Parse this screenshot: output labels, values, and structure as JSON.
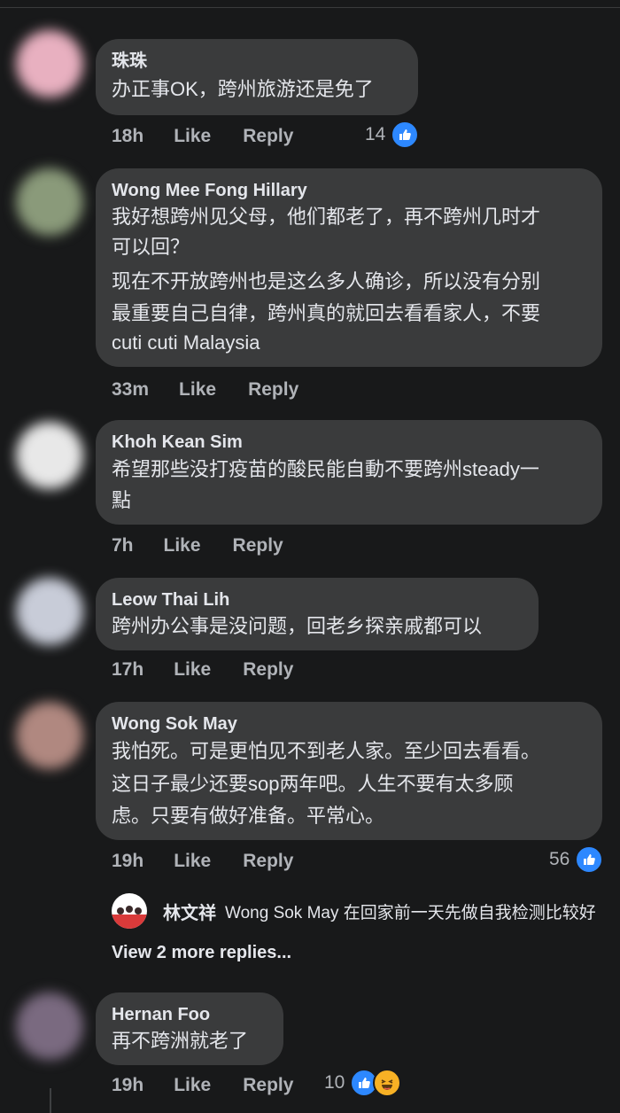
{
  "comments": [
    {
      "author": "珠珠",
      "lines": [
        "办正事OK，跨州旅游还是免了"
      ],
      "time": "18h",
      "like": "Like",
      "reply": "Reply",
      "reactions": "14",
      "avatar_color": "#e8b0c0"
    },
    {
      "author": "Wong Mee Fong Hillary",
      "lines": [
        "我好想跨州见父母，他们都老了，再不跨州几时才",
        "可以回？",
        "现在不开放跨州也是这么多人确诊，所以没有分别",
        "最重要自己自律，跨州真的就回去看看家人，不要",
        "cuti cuti Malaysia"
      ],
      "time": "33m",
      "like": "Like",
      "reply": "Reply",
      "avatar_color": "#8a9a7a"
    },
    {
      "author": "Khoh Kean Sim",
      "lines": [
        "希望那些没打疫苗的酸民能自動不要跨州steady一",
        "點"
      ],
      "time": "7h",
      "like": "Like",
      "reply": "Reply",
      "avatar_color": "#e8e8e8"
    },
    {
      "author": "Leow Thai Lih",
      "lines": [
        "跨州办公事是没问题，回老乡探亲戚都可以"
      ],
      "time": "17h",
      "like": "Like",
      "reply": "Reply",
      "avatar_color": "#c8ccd8"
    },
    {
      "author": "Wong Sok May",
      "lines": [
        "我怕死。可是更怕见不到老人家。至少回去看看。",
        "这日子最少还要sop两年吧。人生不要有太多顾",
        "虑。只要有做好准备。平常心。"
      ],
      "time": "19h",
      "like": "Like",
      "reply": "Reply",
      "reactions": "56",
      "avatar_color": "#b08880"
    },
    {
      "author": "Hernan Foo",
      "lines": [
        "再不跨洲就老了"
      ],
      "time": "19h",
      "like": "Like",
      "reply": "Reply",
      "reactions": "10",
      "avatar_color": "#7a6a80"
    }
  ],
  "reply_preview": {
    "name": "林文祥",
    "text": "Wong Sok May 在回家前一天先做自我检测比较好"
  },
  "view_more": "View 2 more replies..."
}
